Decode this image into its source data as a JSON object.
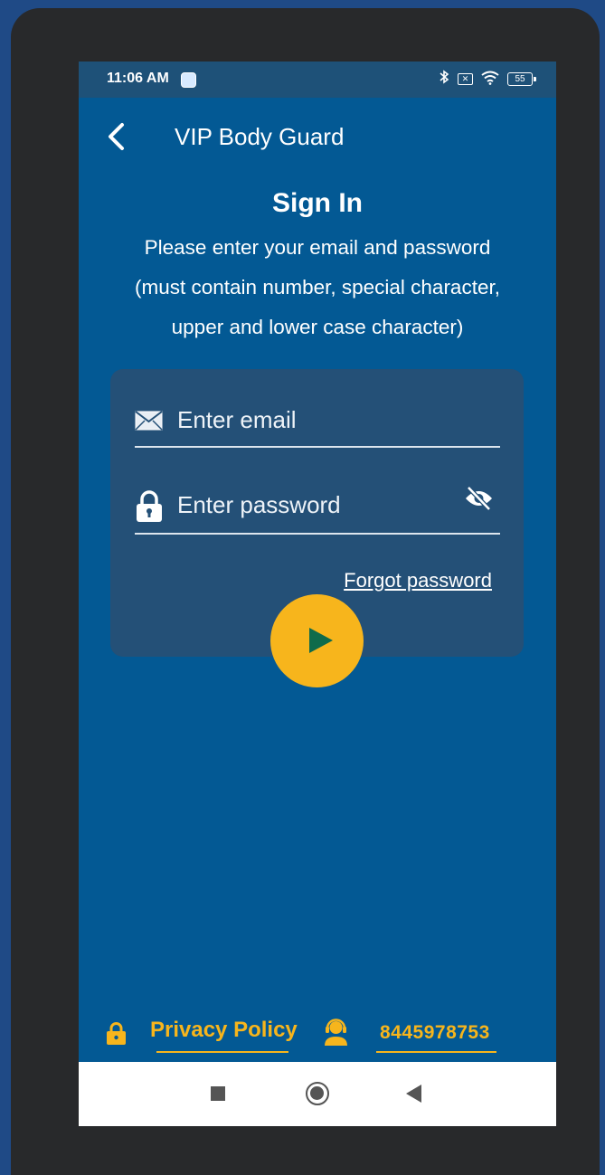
{
  "status_bar": {
    "time": "11:06 AM",
    "battery": "55",
    "icons": [
      "app-notification-icon",
      "bluetooth-icon",
      "no-sim-icon",
      "wifi-icon",
      "battery-icon"
    ]
  },
  "header": {
    "title": "VIP Body Guard",
    "back_icon": "chevron-left-icon"
  },
  "sign_in": {
    "heading": "Sign In",
    "instructions": [
      "Please enter your email and password",
      "(must contain number, special character,",
      "upper and lower case character)"
    ]
  },
  "form": {
    "email_placeholder": "Enter email",
    "email_value": "",
    "password_placeholder": "Enter password",
    "password_value": "",
    "forgot_password": "Forgot password",
    "submit_icon": "play-icon"
  },
  "footer": {
    "privacy_policy": "Privacy Policy",
    "phone": "8445978753"
  },
  "colors": {
    "background": "#035994",
    "card": "#245077",
    "accent": "#f7b51c",
    "play": "#0e6b4b"
  }
}
